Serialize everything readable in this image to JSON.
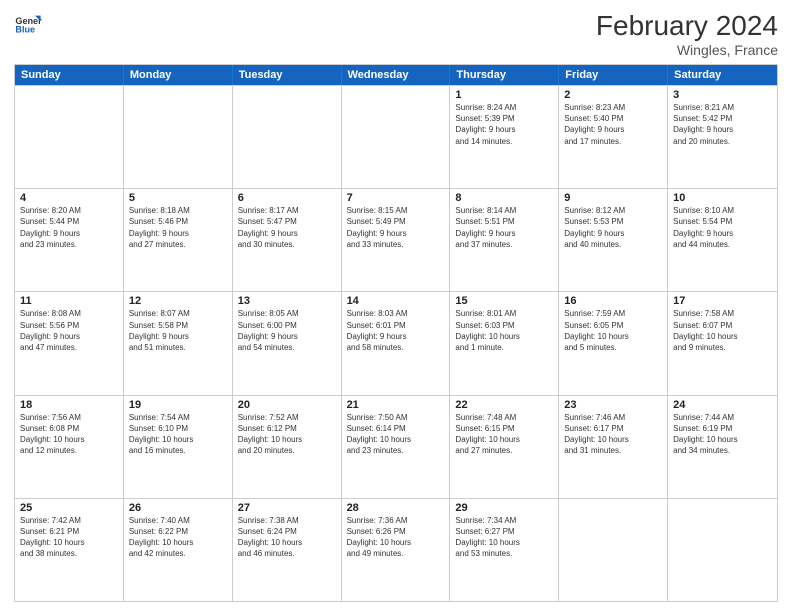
{
  "header": {
    "logo_general": "General",
    "logo_blue": "Blue",
    "title": "February 2024",
    "location": "Wingles, France"
  },
  "weekdays": [
    "Sunday",
    "Monday",
    "Tuesday",
    "Wednesday",
    "Thursday",
    "Friday",
    "Saturday"
  ],
  "rows": [
    [
      {
        "day": "",
        "info": ""
      },
      {
        "day": "",
        "info": ""
      },
      {
        "day": "",
        "info": ""
      },
      {
        "day": "",
        "info": ""
      },
      {
        "day": "1",
        "info": "Sunrise: 8:24 AM\nSunset: 5:39 PM\nDaylight: 9 hours\nand 14 minutes."
      },
      {
        "day": "2",
        "info": "Sunrise: 8:23 AM\nSunset: 5:40 PM\nDaylight: 9 hours\nand 17 minutes."
      },
      {
        "day": "3",
        "info": "Sunrise: 8:21 AM\nSunset: 5:42 PM\nDaylight: 9 hours\nand 20 minutes."
      }
    ],
    [
      {
        "day": "4",
        "info": "Sunrise: 8:20 AM\nSunset: 5:44 PM\nDaylight: 9 hours\nand 23 minutes."
      },
      {
        "day": "5",
        "info": "Sunrise: 8:18 AM\nSunset: 5:46 PM\nDaylight: 9 hours\nand 27 minutes."
      },
      {
        "day": "6",
        "info": "Sunrise: 8:17 AM\nSunset: 5:47 PM\nDaylight: 9 hours\nand 30 minutes."
      },
      {
        "day": "7",
        "info": "Sunrise: 8:15 AM\nSunset: 5:49 PM\nDaylight: 9 hours\nand 33 minutes."
      },
      {
        "day": "8",
        "info": "Sunrise: 8:14 AM\nSunset: 5:51 PM\nDaylight: 9 hours\nand 37 minutes."
      },
      {
        "day": "9",
        "info": "Sunrise: 8:12 AM\nSunset: 5:53 PM\nDaylight: 9 hours\nand 40 minutes."
      },
      {
        "day": "10",
        "info": "Sunrise: 8:10 AM\nSunset: 5:54 PM\nDaylight: 9 hours\nand 44 minutes."
      }
    ],
    [
      {
        "day": "11",
        "info": "Sunrise: 8:08 AM\nSunset: 5:56 PM\nDaylight: 9 hours\nand 47 minutes."
      },
      {
        "day": "12",
        "info": "Sunrise: 8:07 AM\nSunset: 5:58 PM\nDaylight: 9 hours\nand 51 minutes."
      },
      {
        "day": "13",
        "info": "Sunrise: 8:05 AM\nSunset: 6:00 PM\nDaylight: 9 hours\nand 54 minutes."
      },
      {
        "day": "14",
        "info": "Sunrise: 8:03 AM\nSunset: 6:01 PM\nDaylight: 9 hours\nand 58 minutes."
      },
      {
        "day": "15",
        "info": "Sunrise: 8:01 AM\nSunset: 6:03 PM\nDaylight: 10 hours\nand 1 minute."
      },
      {
        "day": "16",
        "info": "Sunrise: 7:59 AM\nSunset: 6:05 PM\nDaylight: 10 hours\nand 5 minutes."
      },
      {
        "day": "17",
        "info": "Sunrise: 7:58 AM\nSunset: 6:07 PM\nDaylight: 10 hours\nand 9 minutes."
      }
    ],
    [
      {
        "day": "18",
        "info": "Sunrise: 7:56 AM\nSunset: 6:08 PM\nDaylight: 10 hours\nand 12 minutes."
      },
      {
        "day": "19",
        "info": "Sunrise: 7:54 AM\nSunset: 6:10 PM\nDaylight: 10 hours\nand 16 minutes."
      },
      {
        "day": "20",
        "info": "Sunrise: 7:52 AM\nSunset: 6:12 PM\nDaylight: 10 hours\nand 20 minutes."
      },
      {
        "day": "21",
        "info": "Sunrise: 7:50 AM\nSunset: 6:14 PM\nDaylight: 10 hours\nand 23 minutes."
      },
      {
        "day": "22",
        "info": "Sunrise: 7:48 AM\nSunset: 6:15 PM\nDaylight: 10 hours\nand 27 minutes."
      },
      {
        "day": "23",
        "info": "Sunrise: 7:46 AM\nSunset: 6:17 PM\nDaylight: 10 hours\nand 31 minutes."
      },
      {
        "day": "24",
        "info": "Sunrise: 7:44 AM\nSunset: 6:19 PM\nDaylight: 10 hours\nand 34 minutes."
      }
    ],
    [
      {
        "day": "25",
        "info": "Sunrise: 7:42 AM\nSunset: 6:21 PM\nDaylight: 10 hours\nand 38 minutes."
      },
      {
        "day": "26",
        "info": "Sunrise: 7:40 AM\nSunset: 6:22 PM\nDaylight: 10 hours\nand 42 minutes."
      },
      {
        "day": "27",
        "info": "Sunrise: 7:38 AM\nSunset: 6:24 PM\nDaylight: 10 hours\nand 46 minutes."
      },
      {
        "day": "28",
        "info": "Sunrise: 7:36 AM\nSunset: 6:26 PM\nDaylight: 10 hours\nand 49 minutes."
      },
      {
        "day": "29",
        "info": "Sunrise: 7:34 AM\nSunset: 6:27 PM\nDaylight: 10 hours\nand 53 minutes."
      },
      {
        "day": "",
        "info": ""
      },
      {
        "day": "",
        "info": ""
      }
    ]
  ]
}
